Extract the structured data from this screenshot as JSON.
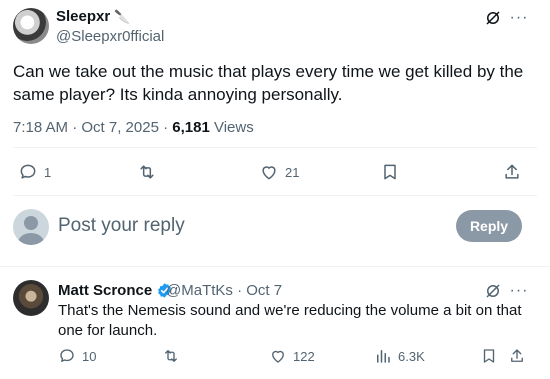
{
  "main_tweet": {
    "author_name": "Sleepxr",
    "author_handle": "@Sleepxr0fficial",
    "text": "Can we take out the music that plays every time we get killed by the same player? Its kinda annoying personally.",
    "time": "7:18 AM · Oct 7, 2025 · ",
    "views_count": "6,181",
    "views_label": " Views",
    "actions": {
      "reply_count": "1",
      "retweet_count": "",
      "like_count": "21"
    }
  },
  "composer": {
    "placeholder": "Post your reply",
    "reply_button": "Reply"
  },
  "reply_tweet": {
    "author_name": "Matt Scronce",
    "author_handle": "@MaTtKs · Oct 7",
    "text": "That's the Nemesis sound and we're reducing the volume a bit on that one for launch.",
    "actions": {
      "reply_count": "10",
      "like_count": "122",
      "views_count": "6.3K"
    }
  },
  "colors": {
    "text_primary": "#0f1419",
    "text_secondary": "#536471",
    "verified_blue": "#1d9bf0",
    "reply_button_bg": "#8b98a5"
  },
  "icons": [
    "grok-icon",
    "more-icon",
    "reply-icon",
    "retweet-icon",
    "like-icon",
    "bookmark-icon",
    "share-icon",
    "verified-icon",
    "views-icon"
  ]
}
